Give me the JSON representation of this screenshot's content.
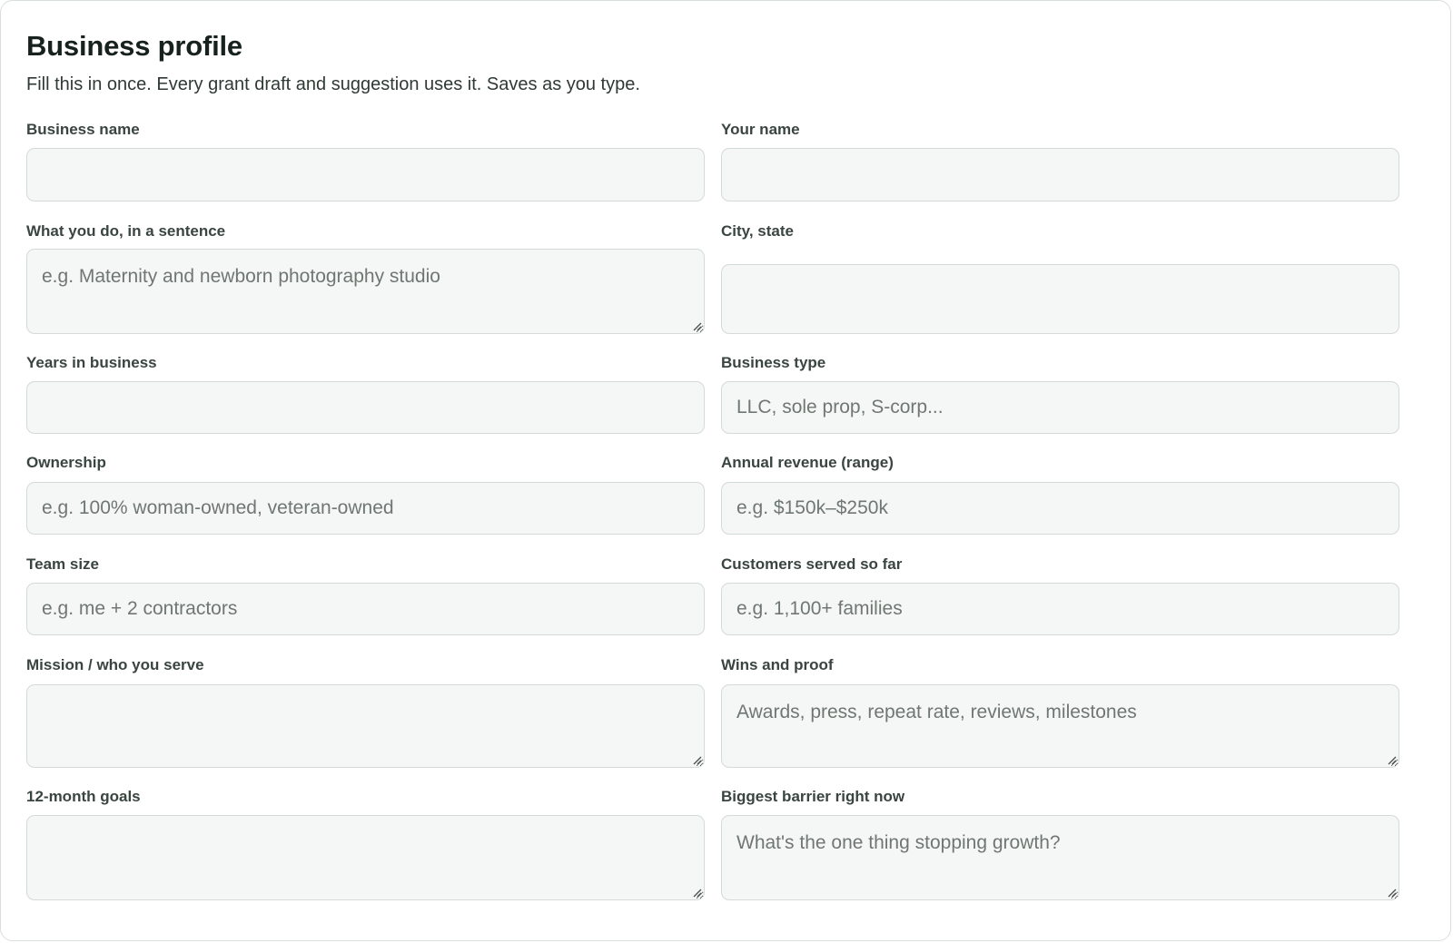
{
  "header": {
    "title": "Business profile",
    "subtitle": "Fill this in once. Every grant draft and suggestion uses it. Saves as you type."
  },
  "fields": {
    "business_name": {
      "label": "Business name",
      "value": "",
      "placeholder": ""
    },
    "your_name": {
      "label": "Your name",
      "value": "",
      "placeholder": ""
    },
    "what_you_do": {
      "label": "What you do, in a sentence",
      "value": "",
      "placeholder": "e.g. Maternity and newborn photography studio"
    },
    "city_state": {
      "label": "City, state",
      "value": "",
      "placeholder": ""
    },
    "years_in_business": {
      "label": "Years in business",
      "value": "",
      "placeholder": ""
    },
    "business_type": {
      "label": "Business type",
      "value": "",
      "placeholder": "LLC, sole prop, S-corp..."
    },
    "ownership": {
      "label": "Ownership",
      "value": "",
      "placeholder": "e.g. 100% woman-owned, veteran-owned"
    },
    "annual_revenue": {
      "label": "Annual revenue (range)",
      "value": "",
      "placeholder": "e.g. $150k–$250k"
    },
    "team_size": {
      "label": "Team size",
      "value": "",
      "placeholder": "e.g. me + 2 contractors"
    },
    "customers_served": {
      "label": "Customers served so far",
      "value": "",
      "placeholder": "e.g. 1,100+ families"
    },
    "mission": {
      "label": "Mission / who you serve",
      "value": "",
      "placeholder": ""
    },
    "wins_proof": {
      "label": "Wins and proof",
      "value": "",
      "placeholder": "Awards, press, repeat rate, reviews, milestones"
    },
    "goals_12mo": {
      "label": "12-month goals",
      "value": "",
      "placeholder": ""
    },
    "biggest_barrier": {
      "label": "Biggest barrier right now",
      "value": "",
      "placeholder": "What's the one thing stopping growth?"
    }
  },
  "colors": {
    "field_background": "#f5f7f6",
    "field_border": "#d4dad6",
    "label_text": "#3a4540",
    "placeholder_text": "#6f7773"
  }
}
